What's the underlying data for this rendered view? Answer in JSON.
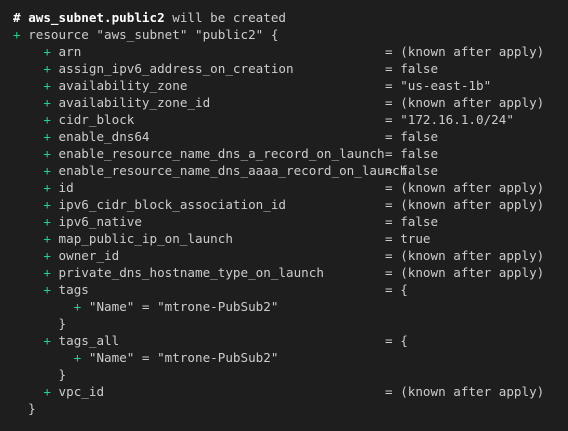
{
  "colors": {
    "background": "#1e1e1e",
    "text": "#cccccc",
    "plus_marker": "#23d18b",
    "heading": "#ffffff"
  },
  "header": {
    "marker": "#",
    "resource_ref": "aws_subnet.public2",
    "suffix": "will be created"
  },
  "resource_open": {
    "plus": "+",
    "text": "resource \"aws_subnet\" \"public2\" {"
  },
  "attributes": [
    {
      "plus": "+",
      "name": "arn",
      "eq": "=",
      "value": "(known after apply)"
    },
    {
      "plus": "+",
      "name": "assign_ipv6_address_on_creation",
      "eq": "=",
      "value": "false"
    },
    {
      "plus": "+",
      "name": "availability_zone",
      "eq": "=",
      "value": "\"us-east-1b\""
    },
    {
      "plus": "+",
      "name": "availability_zone_id",
      "eq": "=",
      "value": "(known after apply)"
    },
    {
      "plus": "+",
      "name": "cidr_block",
      "eq": "=",
      "value": "\"172.16.1.0/24\""
    },
    {
      "plus": "+",
      "name": "enable_dns64",
      "eq": "=",
      "value": "false"
    },
    {
      "plus": "+",
      "name": "enable_resource_name_dns_a_record_on_launch",
      "eq": "=",
      "value": "false"
    },
    {
      "plus": "+",
      "name": "enable_resource_name_dns_aaaa_record_on_launch",
      "eq": "=",
      "value": "false"
    },
    {
      "plus": "+",
      "name": "id",
      "eq": "=",
      "value": "(known after apply)"
    },
    {
      "plus": "+",
      "name": "ipv6_cidr_block_association_id",
      "eq": "=",
      "value": "(known after apply)"
    },
    {
      "plus": "+",
      "name": "ipv6_native",
      "eq": "=",
      "value": "false"
    },
    {
      "plus": "+",
      "name": "map_public_ip_on_launch",
      "eq": "=",
      "value": "true"
    },
    {
      "plus": "+",
      "name": "owner_id",
      "eq": "=",
      "value": "(known after apply)"
    },
    {
      "plus": "+",
      "name": "private_dns_hostname_type_on_launch",
      "eq": "=",
      "value": "(known after apply)"
    }
  ],
  "tags": {
    "plus": "+",
    "name": "tags",
    "eq": "=",
    "open": "{",
    "entry_plus": "+",
    "entry": "\"Name\" = \"mtrone-PubSub2\"",
    "close": "}"
  },
  "tags_all": {
    "plus": "+",
    "name": "tags_all",
    "eq": "=",
    "open": "{",
    "entry_plus": "+",
    "entry": "\"Name\" = \"mtrone-PubSub2\"",
    "close": "}"
  },
  "vpc_id": {
    "plus": "+",
    "name": "vpc_id",
    "eq": "=",
    "value": "(known after apply)"
  },
  "resource_close": "}"
}
